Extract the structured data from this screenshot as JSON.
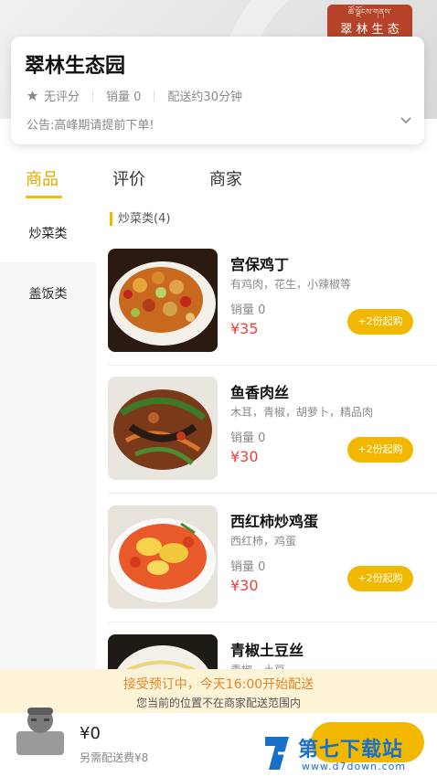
{
  "store": {
    "name": "翠林生态园",
    "logo_text": "翠 林 生 态",
    "logo_tibetan": "ཚོ་ལྗོངས་གནས་",
    "rating": "无评分",
    "sales": "销量 0",
    "delivery": "配送约30分钟",
    "notice": "公告:高峰期请提前下单!"
  },
  "tabs": [
    {
      "label": "商品"
    },
    {
      "label": "评价"
    },
    {
      "label": "商家"
    }
  ],
  "sidebar": {
    "items": [
      {
        "label": "炒菜类"
      },
      {
        "label": "盖饭类"
      }
    ]
  },
  "category": {
    "title": "炒菜类(4)"
  },
  "dishes": [
    {
      "name": "宫保鸡丁",
      "desc": "有鸡肉，花生，小辣椒等",
      "sales": "销量 0",
      "price": "¥35",
      "button": "+2份起购"
    },
    {
      "name": "鱼香肉丝",
      "desc": "木耳，青椒，胡萝卜，精品肉",
      "sales": "销量 0",
      "price": "¥30",
      "button": "+2份起购"
    },
    {
      "name": "西红柿炒鸡蛋",
      "desc": "西红柿，鸡蛋",
      "sales": "销量 0",
      "price": "¥30",
      "button": "+2份起购"
    },
    {
      "name": "青椒土豆丝",
      "desc": "青椒，土豆"
    }
  ],
  "preorder": {
    "line1": "接受预订中，今天16:00开始配送",
    "line2": "您当前的位置不在商家配送范围内"
  },
  "cart": {
    "amount": "¥0",
    "fee": "另需配送费¥8"
  },
  "watermark": {
    "title": "第七下载站",
    "url": "www.d7down.com"
  },
  "colors": {
    "accent": "#f2b800",
    "price": "#e8433a",
    "notice": "#e2872a"
  }
}
